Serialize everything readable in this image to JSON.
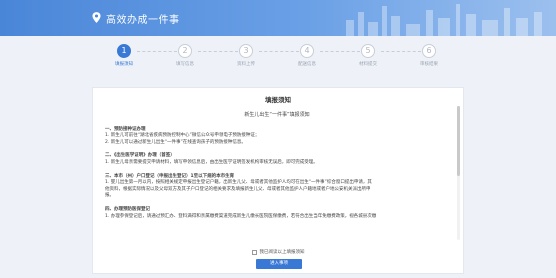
{
  "header": {
    "title": "高效办成一件事",
    "logo_icon": "location-pin-icon"
  },
  "steps": [
    {
      "num": "1",
      "label": "填报须知",
      "active": true
    },
    {
      "num": "2",
      "label": "填写信息",
      "active": false
    },
    {
      "num": "3",
      "label": "资料上传",
      "active": false
    },
    {
      "num": "4",
      "label": "配送信息",
      "active": false
    },
    {
      "num": "5",
      "label": "材料提交",
      "active": false
    },
    {
      "num": "6",
      "label": "审核结果",
      "active": false
    }
  ],
  "panel": {
    "title": "填报须知",
    "doc_title": "新生儿出生“一件事”填报须知",
    "sections": [
      {
        "head": "一、预防接种证办理",
        "lines": [
          "1. 新生儿可前往“湖北省疾病预防控制中心”微信公众号申领电子预防接种证；",
          "2. 新生儿可以通过新生儿出生“一件事”在线查询孩子的预防接种信息。"
        ]
      },
      {
        "head": "二、《出生医学证明》办理（首签）",
        "lines": [
          "1. 新生儿母亲需要提交申请材料，填写申领信息后，由出生医学证明签发机构审核无误后，即可完成受理。"
        ]
      },
      {
        "head": "三、本市（州）户口登记（申报出生登记）1至以下规的本市生育",
        "lines": [
          "1. 婴儿出生第一月以内，按照相关规定申报出生登记户籍，出新生儿父、母或者其他监护人均可在出生“一件事”综合窗口提出申请，其",
          "他资料，根据实际情况以及父母双方及其子户口登记的相关要求及填报新生儿父、母或者其他监护人户籍地或者户地公安机关派出所申",
          "报。"
        ]
      },
      {
        "head": "四、办理预防医保登记",
        "lines": [
          "1. 办理参保登记后，请通过预汇办、登料满得和亲属缴费渠道完成新生儿缴长医院医保缴费，若符合出生当年免缴费政策，视各城县次缴"
        ]
      }
    ],
    "agree_label": "我已阅读以上填报须知",
    "enter_button": "进入事项"
  },
  "colors": {
    "accent": "#3a78d6",
    "header_start": "#4a86d8"
  }
}
